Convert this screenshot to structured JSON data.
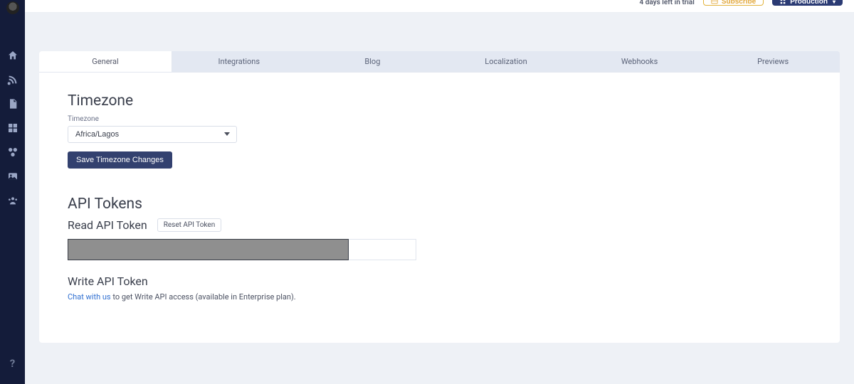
{
  "header": {
    "trial_text": "4 days left in trial",
    "subscribe_label": "Subscribe",
    "env_label": "Production"
  },
  "tabs": [
    {
      "label": "General",
      "active": true
    },
    {
      "label": "Integrations",
      "active": false
    },
    {
      "label": "Blog",
      "active": false
    },
    {
      "label": "Localization",
      "active": false
    },
    {
      "label": "Webhooks",
      "active": false
    },
    {
      "label": "Previews",
      "active": false
    }
  ],
  "timezone": {
    "section_title": "Timezone",
    "field_label": "Timezone",
    "selected_value": "Africa/Lagos",
    "save_button": "Save Timezone Changes"
  },
  "api_tokens": {
    "section_title": "API Tokens",
    "read": {
      "heading": "Read API Token",
      "reset_label": "Reset API Token",
      "value": ""
    },
    "write": {
      "heading": "Write API Token",
      "chat_link": "Chat with us",
      "trailing_text": " to get Write API access (available in Enterprise plan)."
    }
  },
  "sidebar_icons": [
    "home",
    "feed",
    "page",
    "grid",
    "integration",
    "media",
    "team"
  ]
}
